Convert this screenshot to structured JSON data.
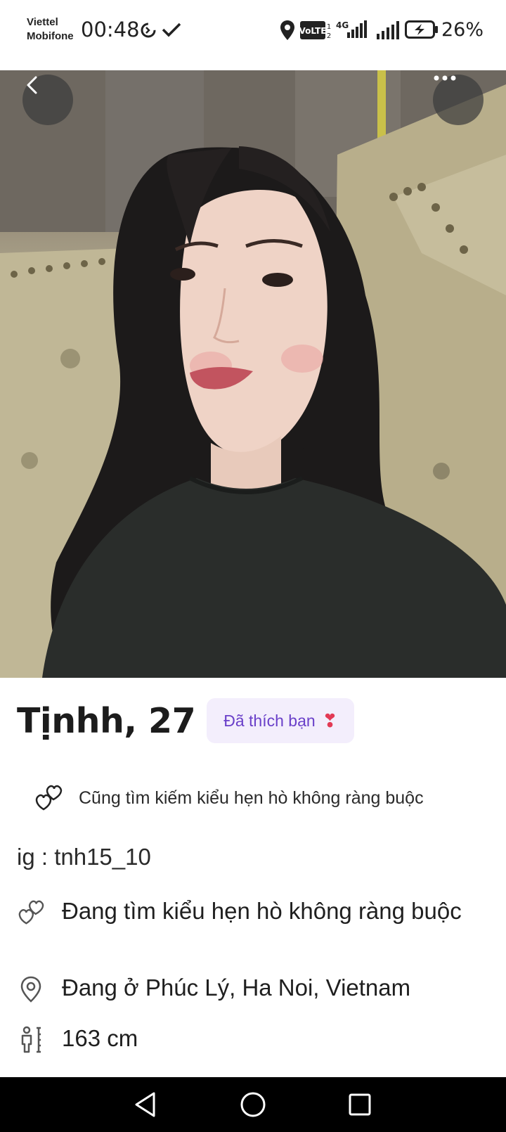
{
  "status_bar": {
    "carrier_line1": "Viettel",
    "carrier_line2": "Mobifone",
    "time": "00:48",
    "battery": "26%",
    "icons": [
      "sync-icon",
      "check-icon",
      "location-icon",
      "volte-icon",
      "4g-signal-icon",
      "signal-icon",
      "battery-charging-icon"
    ]
  },
  "header": {
    "back_icon": "chevron-left-icon",
    "more_icon": "more-horizontal-icon"
  },
  "profile": {
    "name_age": "Tịnhh, 27",
    "liked_badge": "Đã thích bạn",
    "liked_emoji": "❣",
    "intent": "Cũng tìm kiếm kiểu hẹn hò không ràng buộc",
    "bio": "ig : tnh15_10",
    "details": [
      {
        "icon": "hearts-icon",
        "text": "Đang tìm kiểu hẹn hò không ràng buộc"
      },
      {
        "icon": "location-pin-icon",
        "text": "Đang ở Phúc Lý, Ha Noi, Vietnam"
      },
      {
        "icon": "height-icon",
        "text": "163 cm"
      }
    ]
  },
  "colors": {
    "badge_bg": "#f3eefc",
    "badge_text": "#6a40c9",
    "nav_bg": "#000000"
  },
  "nav_bar": {
    "buttons": [
      "back-triangle-icon",
      "home-circle-icon",
      "recents-square-icon"
    ]
  }
}
